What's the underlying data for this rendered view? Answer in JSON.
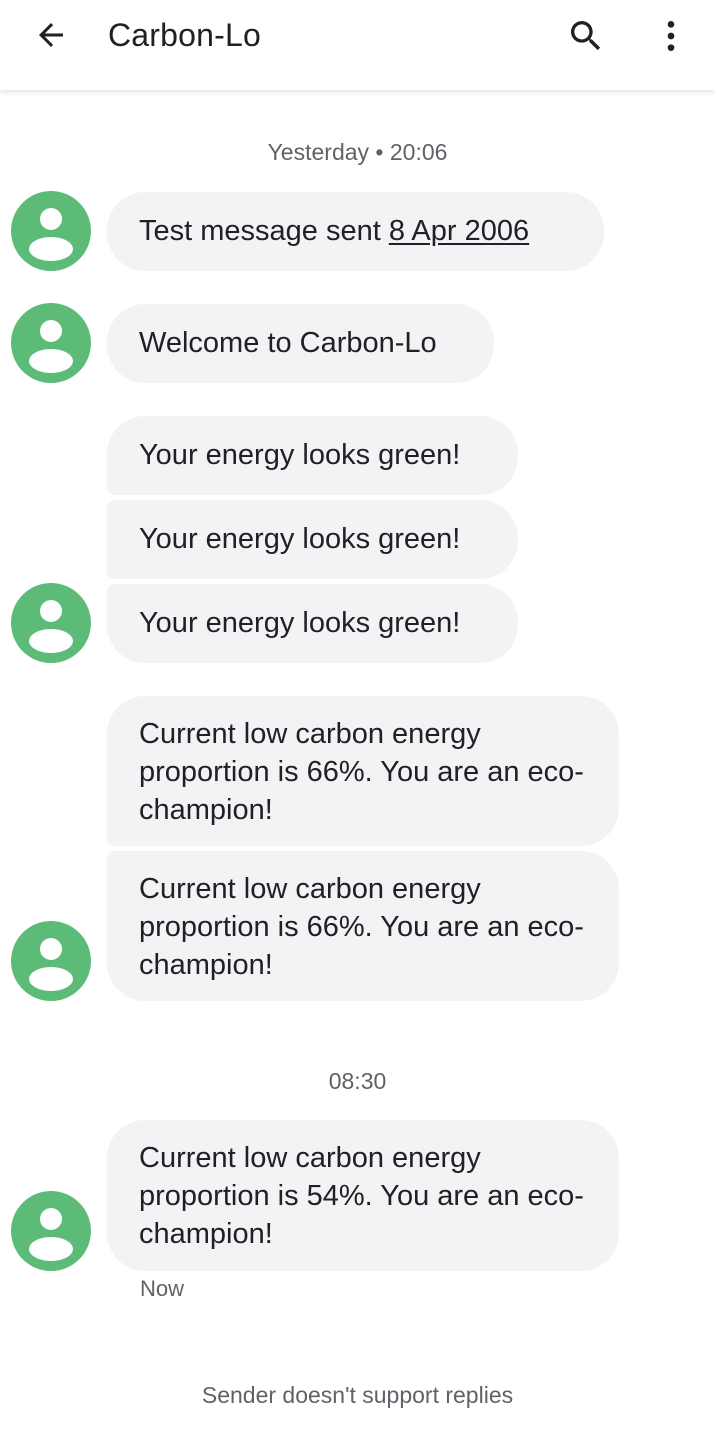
{
  "header": {
    "title": "Carbon-Lo",
    "back_icon": "arrow-back-icon",
    "search_icon": "search-icon",
    "more_icon": "more-vert-icon"
  },
  "timestamps": {
    "first": "Yesterday • 20:06",
    "second": "08:30"
  },
  "messages": [
    {
      "text_prefix": "Test message sent ",
      "text_link": "8 Apr 2006"
    },
    {
      "text": "Welcome to Carbon-Lo"
    },
    {
      "text": "Your energy looks green!"
    },
    {
      "text": "Your energy looks green!"
    },
    {
      "text": "Your energy looks green!"
    },
    {
      "text": "Current low carbon energy proportion is 66%. You are an eco-champion!"
    },
    {
      "text": "Current low carbon energy proportion is 66%. You are an eco-champion!"
    },
    {
      "text": "Current low carbon energy proportion is 54%. You are an eco-champion!"
    }
  ],
  "last_message_status": "Now",
  "footer": {
    "note": "Sender doesn't support replies"
  },
  "colors": {
    "avatar_bg": "#5cbb77",
    "bubble_bg": "#f1f3f4",
    "secondary_text": "#5f6368"
  },
  "avatar_icon": "person-icon"
}
